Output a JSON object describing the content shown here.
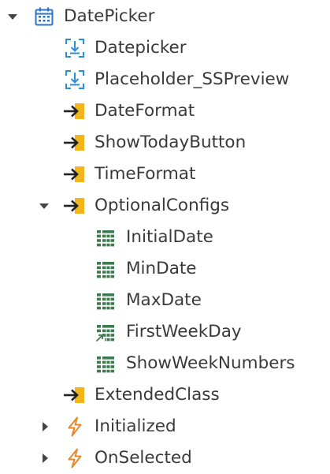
{
  "tree": {
    "root": {
      "label": "DatePicker",
      "icon": "calendar-icon",
      "expanded": true
    },
    "placeholders": [
      {
        "label": "Datepicker",
        "icon": "placeholder-icon"
      },
      {
        "label": "Placeholder_SSPreview",
        "icon": "placeholder-icon"
      }
    ],
    "inputs": [
      {
        "label": "DateFormat",
        "icon": "input-parameter-icon"
      },
      {
        "label": "ShowTodayButton",
        "icon": "input-parameter-icon"
      },
      {
        "label": "TimeFormat",
        "icon": "input-parameter-icon"
      }
    ],
    "optional_configs": {
      "label": "OptionalConfigs",
      "icon": "input-parameter-icon",
      "expanded": true,
      "children": [
        {
          "label": "InitialDate",
          "icon": "structure-attribute-icon"
        },
        {
          "label": "MinDate",
          "icon": "structure-attribute-icon"
        },
        {
          "label": "MaxDate",
          "icon": "structure-attribute-icon"
        },
        {
          "label": "FirstWeekDay",
          "icon": "structure-attribute-reference-icon"
        },
        {
          "label": "ShowWeekNumbers",
          "icon": "structure-attribute-icon"
        }
      ]
    },
    "extended_class": {
      "label": "ExtendedClass",
      "icon": "input-parameter-icon"
    },
    "events": [
      {
        "label": "Initialized",
        "icon": "event-icon",
        "expanded": false
      },
      {
        "label": "OnSelected",
        "icon": "event-icon",
        "expanded": false
      }
    ]
  },
  "colors": {
    "text": "#3a3a3a",
    "calendar": "#2b73c8",
    "placeholder": "#2b8fd6",
    "input_arrow": "#222222",
    "input_tab": "#f2b51c",
    "attribute": "#3d7a4d",
    "event": "#e8862a",
    "toggle": "#444444"
  }
}
